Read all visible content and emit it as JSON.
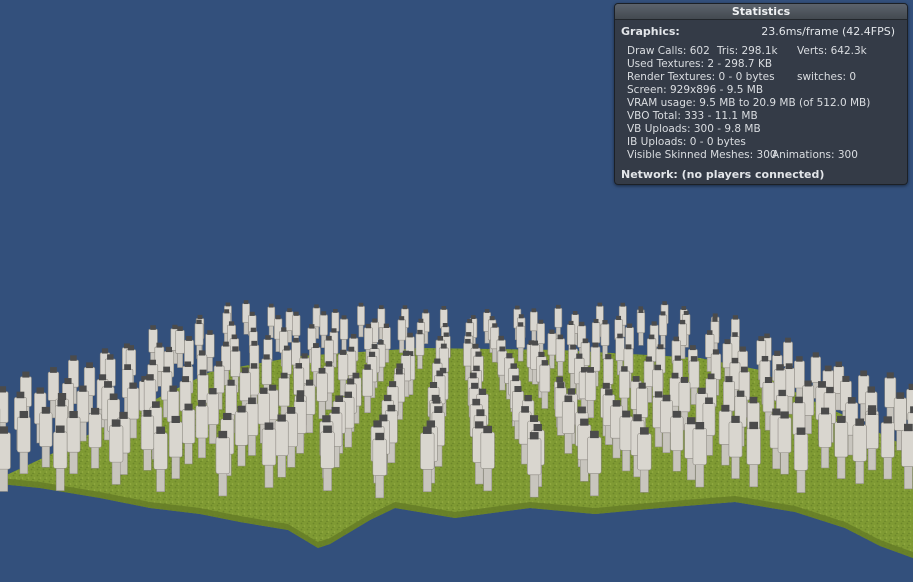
{
  "statistics": {
    "title": "Statistics",
    "graphics_label": "Graphics:",
    "graphics_value": "23.6ms/frame (42.4FPS)",
    "draw_calls": "Draw Calls: 602",
    "tris": "Tris: 298.1k",
    "verts": "Verts: 642.3k",
    "used_textures": "Used Textures: 2 - 298.7 KB",
    "render_textures": "Render Textures: 0 - 0 bytes",
    "switches": "switches: 0",
    "screen": "Screen: 929x896 - 9.5 MB",
    "vram": "VRAM usage: 9.5 MB to 20.9 MB (of 512.0 MB)",
    "vbo_total": "VBO Total: 333 - 11.1 MB",
    "vb_uploads": "VB Uploads: 300 - 9.8 MB",
    "ib_uploads": "IB Uploads: 0 - 0 bytes",
    "skinned_meshes": "Visible Skinned Meshes: 300",
    "animations": "Animations: 300",
    "network": "Network: (no players connected)"
  },
  "scene": {
    "background_color": "#33507c",
    "terrain_color": "#7f9a33",
    "character_color": "#d9d6cf",
    "character_count": 300
  }
}
